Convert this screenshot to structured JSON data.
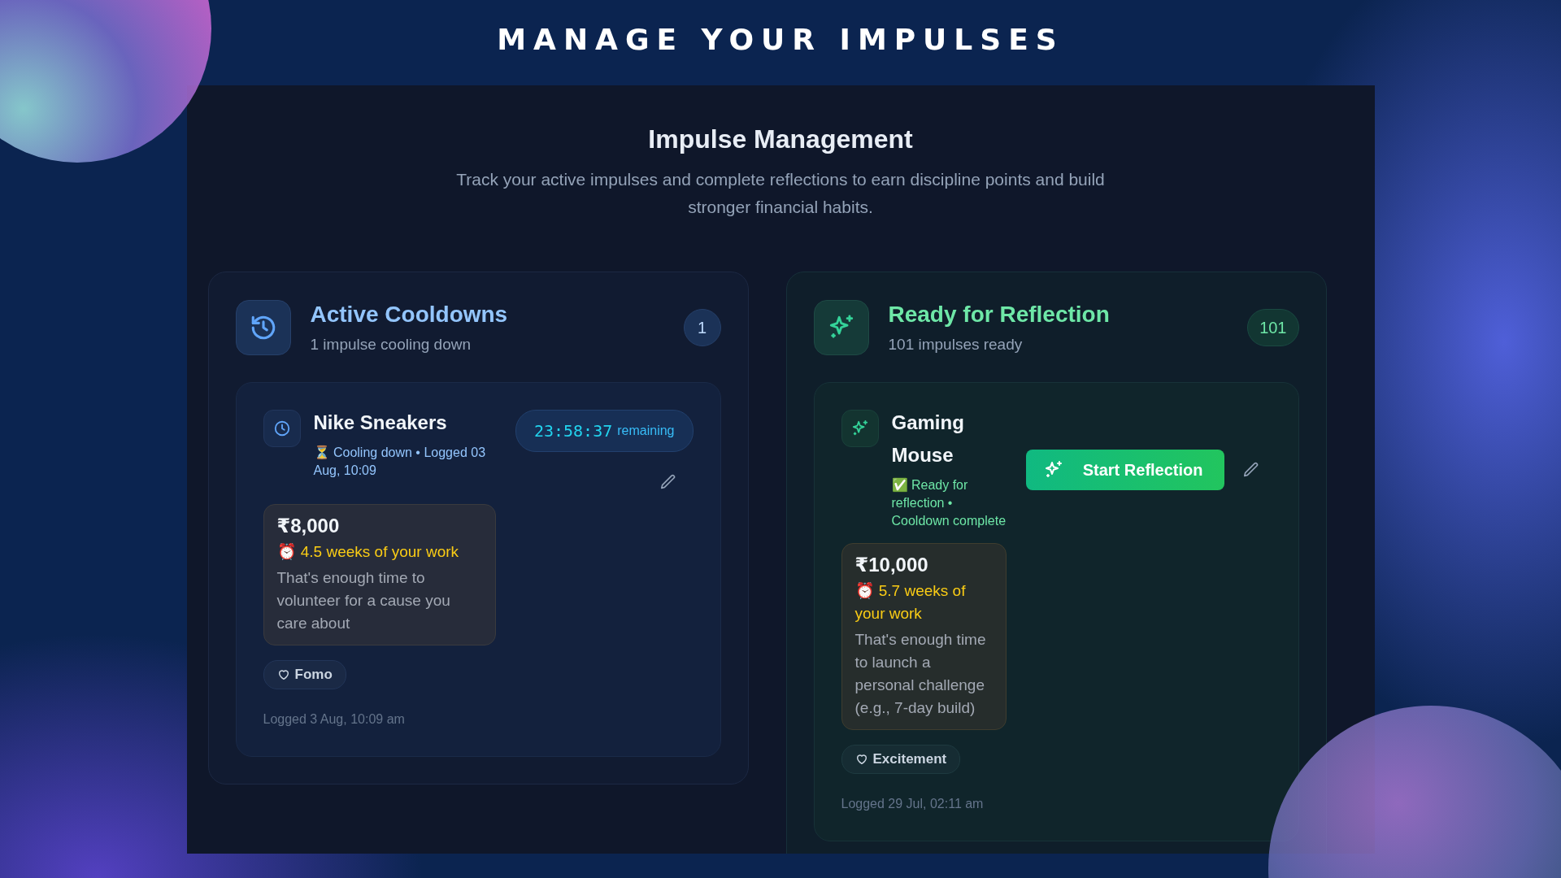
{
  "banner": {
    "title": "MANAGE YOUR IMPULSES"
  },
  "header": {
    "title": "Impulse Management",
    "subtitle": "Track your active impulses and complete reflections to earn discipline points and build stronger financial habits."
  },
  "sections": [
    {
      "kind": "cooldown",
      "title": "Active Cooldowns",
      "subtitle": "1 impulse cooling down",
      "count": "1",
      "items": [
        {
          "name": "Nike Sneakers",
          "status": "⏳ Cooling down • Logged 03 Aug, 10:09",
          "timer": "23:58:37",
          "timer_label": "remaining",
          "amount": "₹8,000",
          "work_time": "⏰ 4.5 weeks of your work",
          "description": "That's enough time to volunteer for a cause you care about",
          "emotion": "Fomo",
          "logged": "Logged 3 Aug, 10:09 am"
        }
      ]
    },
    {
      "kind": "ready",
      "title": "Ready for Reflection",
      "subtitle": "101 impulses ready",
      "count": "101",
      "items": [
        {
          "name": "Gaming Mouse",
          "status": "✅ Ready for reflection • Cooldown complete",
          "action": "Start Reflection",
          "amount": "₹10,000",
          "work_time": "⏰ 5.7 weeks of your work",
          "description": "That's enough time to launch a personal challenge (e.g., 7-day build)",
          "emotion": "Excitement",
          "logged": "Logged 29 Jul, 02:11 am"
        }
      ]
    }
  ]
}
